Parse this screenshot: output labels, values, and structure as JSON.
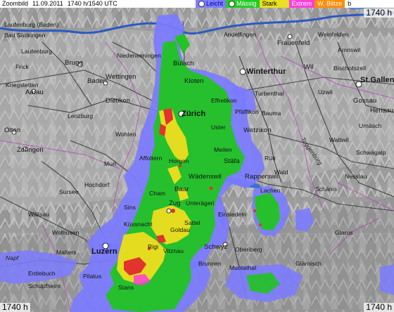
{
  "header": {
    "mode_label": "Zoombild",
    "date": "11.09.2011",
    "time": "1740 h/1540 UTC"
  },
  "legend": [
    {
      "label": "Leicht",
      "color": "#7d7dff",
      "text_color": "#0000a0"
    },
    {
      "label": "Mässig",
      "color": "#22cc22",
      "text_color": "#ffffff"
    },
    {
      "label": "Stark",
      "color": "#e8e020",
      "text_color": "#000000"
    },
    {
      "label": "Extrem",
      "color": "#ff3cdc",
      "text_color": "#ffffff"
    },
    {
      "label": "W. Blitze",
      "color": "#ff8c00",
      "text_color": "#ffffff"
    },
    {
      "label": "b",
      "color": "#ffffff",
      "text_color": "#000000"
    }
  ],
  "corners": {
    "top_right": "1740 h",
    "bottom_left": "1740 h",
    "bottom_right": "1740 h"
  },
  "places": {
    "laufenburg_baden": "Laufenburg (Baden)",
    "baden_saeckingen": "Bad Säckingen",
    "laufenburg": "Laufenburg",
    "frick": "Frick",
    "brugg": "Brugg",
    "wettingen": "Wettingen",
    "baden": "Baden",
    "niederweningen": "Niederweningen",
    "buelach": "Bülach",
    "kloten": "Kloten",
    "winterthur": "Winterthur",
    "frauenfeld": "Frauenfeld",
    "wil": "Wil",
    "bischofszell": "Bischofszell",
    "st_gallen": "St.Gallen",
    "gossau": "Gossau",
    "herisau": "Herisau",
    "aarau": "Aarau",
    "kreuzlingen": "Kriegstetten",
    "olten": "Olten",
    "zofingen": "Zofingen",
    "dietikon": "Dietikon",
    "lenzburg": "Lenzburg",
    "zuerich": "Zürich",
    "effretikon": "Effretikon",
    "pfaeffikon": "Pfäffikon",
    "bauma": "Bauma",
    "uster": "Uster",
    "wetzikon": "Wetzikon",
    "wohlen": "Wohlen",
    "affoltern": "Affoltern",
    "horgen": "Horgen",
    "meilen": "Meilen",
    "staefa": "Stäfa",
    "rueti": "Rüti",
    "rapperswil": "Rapperswil",
    "wald": "Wald",
    "waedenswil": "Wädenswil",
    "baar": "Baar",
    "zug": "Zug",
    "unteraegeri": "Unterägeri",
    "einsiedeln": "Einsiedeln",
    "lachen": "Lachen",
    "schaenis": "Schänis",
    "glarus": "Glarus",
    "sursee": "Sursee",
    "willisau": "Willisau",
    "wolhusen": "Wolhusen",
    "luzern": "Luzern",
    "malters": "Malters",
    "kuessnacht": "Küssnacht",
    "rigi": "Rigi",
    "vitznau": "Vitznau",
    "goldau": "Goldau",
    "sattel": "Sattel",
    "schwyz": "Schwyz",
    "brunnen": "Brunnen",
    "oberiberg": "Oberiberg",
    "muotathal": "Muotathal",
    "glaernisch": "Glärnisch",
    "entlebuch": "Entlebuch",
    "schuepfheim": "Schüpfheim",
    "stans": "Stans",
    "pilatus": "Pilatus",
    "napf": "Napf",
    "amriswil": "Amriswil",
    "weinfelden": "Weinfelden",
    "andelfingen": "Andelfingen",
    "turbenthal": "Turbenthal",
    "hochdorf": "Hochdorf",
    "muri": "Muri",
    "cham": "Cham",
    "sins": "Sins",
    "uzwil": "Uzwil",
    "urnaesch": "Urnäsch",
    "wattwil": "Wattwil",
    "nesslau": "Nesslau",
    "schwaegalp": "Schwägalp",
    "toggenburg": "Toggenburg"
  }
}
